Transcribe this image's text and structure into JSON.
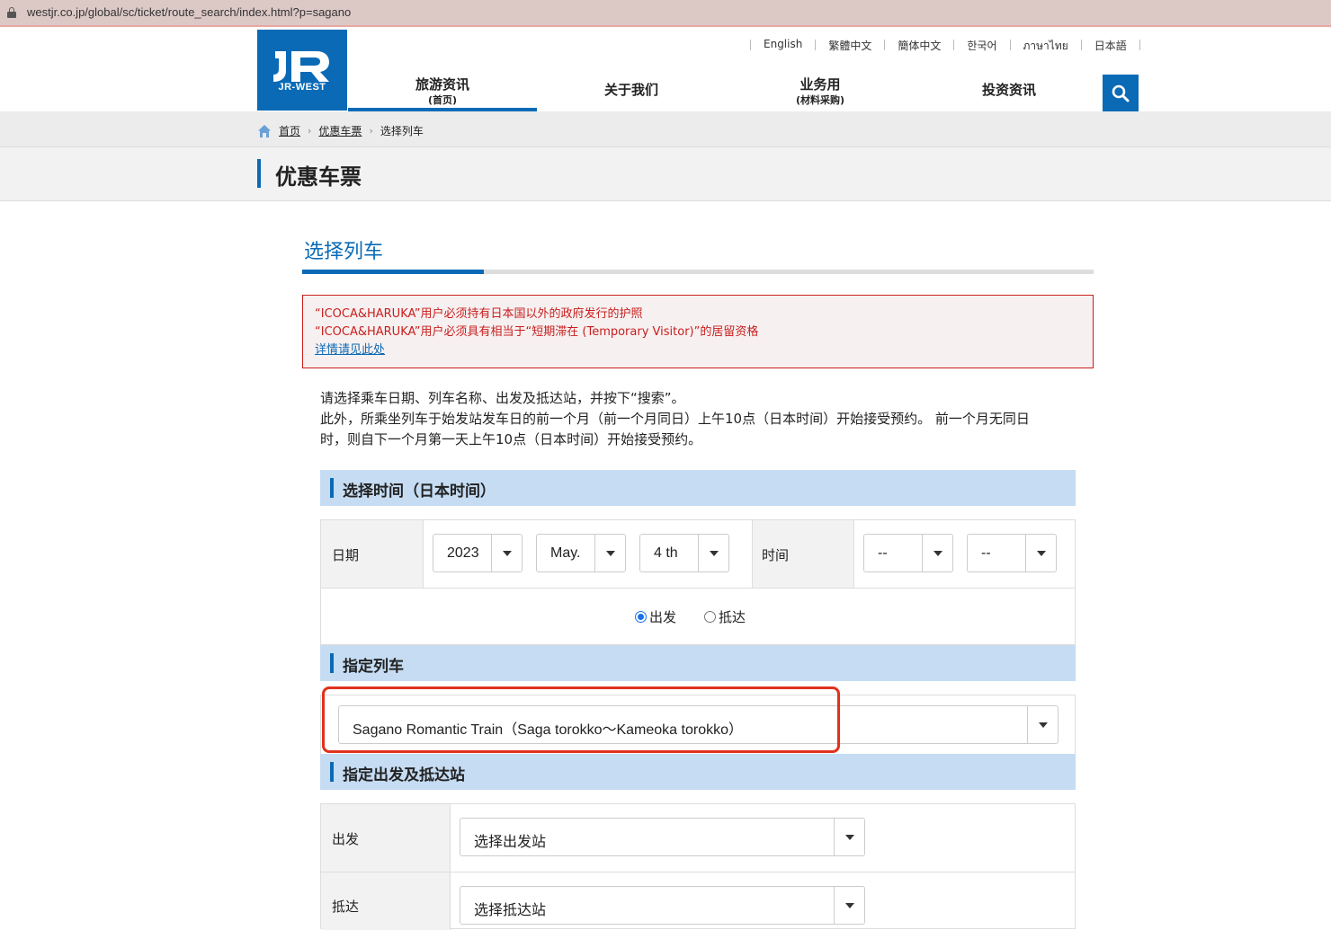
{
  "browser": {
    "url": "westjr.co.jp/global/sc/ticket/route_search/index.html?p=sagano"
  },
  "logo": {
    "text": "JR-WEST"
  },
  "languages": [
    "English",
    "繁體中文",
    "簡体中文",
    "한국어",
    "ภาษาไทย",
    "日本語"
  ],
  "nav": [
    {
      "label": "旅游资讯",
      "sub": "(首页)"
    },
    {
      "label": "关于我们",
      "sub": ""
    },
    {
      "label": "业务用",
      "sub": "(材料采购)"
    },
    {
      "label": "投资资讯",
      "sub": ""
    }
  ],
  "breadcrumb": {
    "home": "首页",
    "discount": "优惠车票",
    "current": "选择列车"
  },
  "page_title": "优惠车票",
  "section_title": "选择列车",
  "alert": {
    "line1": "“ICOCA&HARUKA”用户必须持有日本国以外的政府发行的护照",
    "line2": "“ICOCA&HARUKA”用户必须具有相当于“短期滞在 (Temporary Visitor)”的居留资格",
    "link": "详情请见此处"
  },
  "intro": {
    "line1": "请选择乘车日期、列车名称、出发及抵达站，并按下“搜索”。",
    "line2": "此外，所乘坐列车于始发站发车日的前一个月（前一个月同日）上午10点（日本时间）开始接受预约。 前一个月无同日",
    "line3": "时，则自下一个月第一天上午10点（日本时间）开始接受预约。"
  },
  "time_section": {
    "heading": "选择时间（日本时间）",
    "date_label": "日期",
    "year": "2023",
    "month": "May.",
    "day": "4 th",
    "time_label": "时间",
    "hour": "--",
    "minute": "--",
    "radio_depart": "出发",
    "radio_arrive": "抵达",
    "selected": "出发"
  },
  "train_section": {
    "heading": "指定列车",
    "selected_train": "Sagano Romantic Train（Saga torokko～Kameoka torokko）"
  },
  "station_section": {
    "heading": "指定出发及抵达站",
    "depart_label": "出发",
    "depart_value": "选择出发站",
    "arrive_label": "抵达",
    "arrive_value": "选择抵达站"
  },
  "colors": {
    "brand": "#0a6ab6",
    "alert": "#c81e1e",
    "band": "#c5dcf3",
    "highlight": "#e0321e"
  }
}
